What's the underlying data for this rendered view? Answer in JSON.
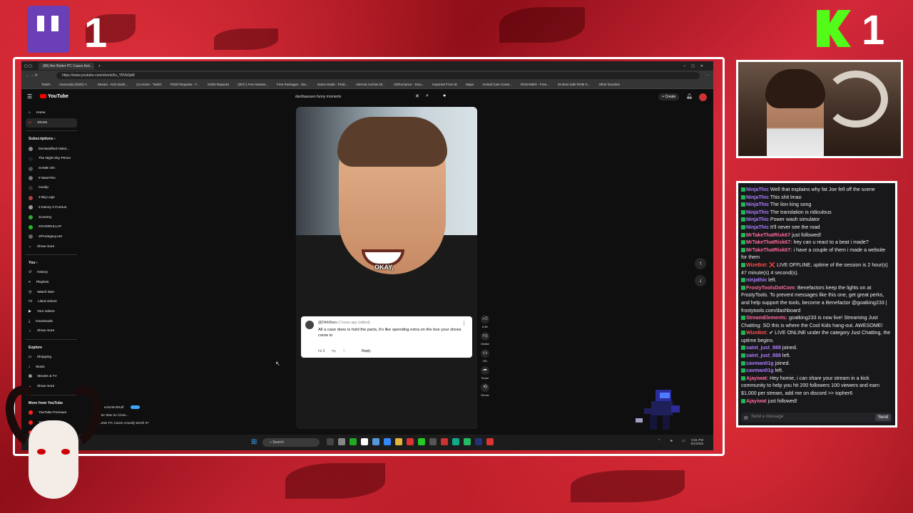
{
  "overlay": {
    "twitch_count": "1",
    "kick_count": "1"
  },
  "browser": {
    "tab_title": "(86) Are Better PC Cases Acti...",
    "url": "https://www.youtube.com/shorts/kx_Y8Vb0pM",
    "bookmarks": [
      "Twitch",
      "Anaconda (2025) Y...",
      "Stream - Kick Dash...",
      "(1) Home - Twitch",
      "FitGirl Repacks - T...",
      "DODI Repacks",
      "(357) | Free Movies...",
      "Free Packages - Ste...",
      "Game Deals - Findi...",
      "Internet Archive Di...",
      "CDRomance - Dow...",
      "Imported From IE",
      "Maps",
      "Animal Care Cente...",
      "ROGAMES - Free...",
      "25 Best Safe ROM S...",
      "Other favorites"
    ]
  },
  "youtube": {
    "logo": "YouTube",
    "search_value": "danthaassen funny moments",
    "create_label": "Create",
    "nav": [
      {
        "label": "Home",
        "icon": "home-icon"
      },
      {
        "label": "Shorts",
        "icon": "shorts-icon",
        "active": true
      }
    ],
    "subscriptions_heading": "Subscriptions",
    "subscriptions": [
      "Declassified Histor...",
      "The Night Sky Prince",
      "GAME ON",
      "# MaxHTec",
      "/noclip",
      "2 Big Lugs",
      "2 Danny 2 Furious",
      "2Lemmy",
      "2OVERKILLAF",
      "2PALlegacy.net"
    ],
    "show_more": "Show more",
    "you_heading": "You",
    "you_items": [
      "History",
      "Playlists",
      "Watch later",
      "Liked videos",
      "Your videos",
      "Downloads"
    ],
    "explore_heading": "Explore",
    "explore_items": [
      "Shopping",
      "Music",
      "Movies & TV"
    ],
    "more_heading": "More from YouTube",
    "more_items": [
      "YouTube Premium",
      "YouTube Studio",
      "YouTube TV"
    ],
    "popup_channel": "echaTechRuff",
    "popup_line1": "...ter Was So Close...",
    "popup_line2": "...etter PC Cases Actually Worth It?",
    "short": {
      "caption": "OKAY,",
      "comment_author": "@D4rk5tars",
      "comment_time": "2 hours ago (edited)",
      "comment_text": "All a case does is hold the parts, it's like spending extra on the box your shoes come in",
      "comment_likes": "1",
      "reply_label": "Reply",
      "likes": "6.5K",
      "dislike_label": "Dislike",
      "comments": "261",
      "share_label": "Share",
      "remix_label": "Remix"
    }
  },
  "taskbar": {
    "search_placeholder": "Search",
    "time": "5:51 PM",
    "date": "5/1/2025"
  },
  "chat": {
    "messages": [
      {
        "user": "NinjaThic",
        "color": "#b07cff",
        "text": "Well that explains why fat Joe fell off the scene"
      },
      {
        "user": "NinjaThic",
        "color": "#b07cff",
        "text": "This shit lmao"
      },
      {
        "user": "NinjaThic",
        "color": "#b07cff",
        "text": "The lion king song"
      },
      {
        "user": "NinjaThic",
        "color": "#b07cff",
        "text": "The translation is ridiculous"
      },
      {
        "user": "NinjaThic",
        "color": "#b07cff",
        "text": "Power wash simulator"
      },
      {
        "user": "NinjaThic",
        "color": "#b07cff",
        "text": "It'll never see the road"
      },
      {
        "user": "MrTakeThatRisk67",
        "color": "#ff6b9a",
        "text": "just followed!"
      },
      {
        "user": "MrTakeThatRisk67:",
        "color": "#ff6b9a",
        "text": "hey can u react to a beat i made?"
      },
      {
        "user": "MrTakeThatRisk67:",
        "color": "#ff6b9a",
        "text": "i have a couple of them i made a website for them"
      },
      {
        "user": "WizeBot:",
        "color": "#ff4d4d",
        "text": "❌ LIVE OFFLINE, uptime of the session is 2 hour(s) 47 minute(s) 4 second(s)."
      },
      {
        "user": "ninjathic",
        "color": "#b07cff",
        "text": "left."
      },
      {
        "user": "FrostyToolsDotCom:",
        "color": "#ff6b9a",
        "text": "Benefactors keep the lights on at FrostyTools. To prevent messages like this one, get great perks, and help support the tools, become a Benefactor @goatking233 | frostytools.com/dashboard"
      },
      {
        "user": "StreamElements:",
        "color": "#ff6b9a",
        "text": "goatking233 is now live! Streaming Just Chatting: SO this is where the Cool Kids hang-out. AWESOME!"
      },
      {
        "user": "WizeBot:",
        "color": "#ff4d4d",
        "text": "✔ LIVE ONLINE under the category Just Chatting, the uptime begins."
      },
      {
        "user": "saint_just_888",
        "color": "#b07cff",
        "text": "joined."
      },
      {
        "user": "saint_just_888",
        "color": "#b07cff",
        "text": "left."
      },
      {
        "user": "cavman01g",
        "color": "#b07cff",
        "text": "joined."
      },
      {
        "user": "cavman01g",
        "color": "#b07cff",
        "text": "left."
      },
      {
        "user": "Ajayiwat:",
        "color": "#ff6b9a",
        "text": "Hey homie, i can share your stream in a kick community to help you hit 200 followers 100 viewers and earn $1,000 per stream, add me on discord >> topher6"
      },
      {
        "user": "Ajayiwat",
        "color": "#ff6b9a",
        "text": "just followed!"
      }
    ],
    "input_placeholder": "Send a message",
    "send_label": "Send"
  }
}
